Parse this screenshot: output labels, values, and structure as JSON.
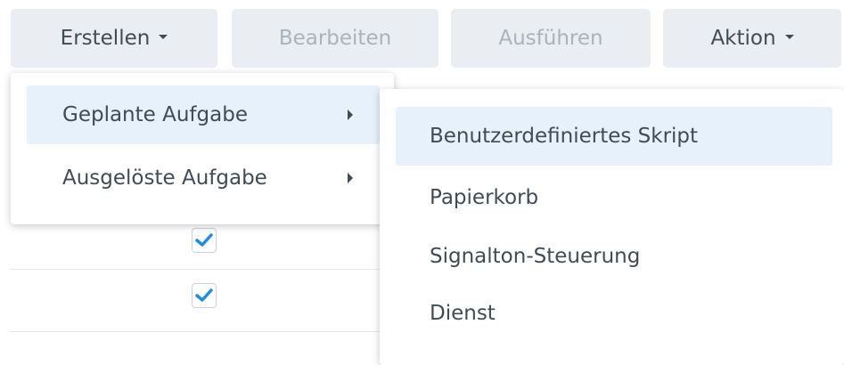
{
  "toolbar": {
    "create_label": "Erstellen",
    "edit_label": "Bearbeiten",
    "run_label": "Ausführen",
    "action_label": "Aktion"
  },
  "create_menu": {
    "items": [
      {
        "label": "Geplante Aufgabe",
        "has_submenu": true,
        "highlighted": true
      },
      {
        "label": "Ausgelöste Aufgabe",
        "has_submenu": true,
        "highlighted": false
      }
    ]
  },
  "scheduled_task_submenu": {
    "items": [
      {
        "label": "Benutzerdefiniertes Skript",
        "highlighted": true
      },
      {
        "label": "Papierkorb"
      },
      {
        "label": "Signalton-Steuerung"
      },
      {
        "label": "Dienst"
      }
    ]
  },
  "task_table": {
    "rows": [
      {
        "enabled": true
      },
      {
        "enabled": true
      }
    ]
  },
  "colors": {
    "button_bg": "#eaeef3",
    "text": "#414b55",
    "disabled_text": "#a9b2bd",
    "highlight_bg": "#e7f1fb",
    "check_blue": "#1b8fe8"
  }
}
